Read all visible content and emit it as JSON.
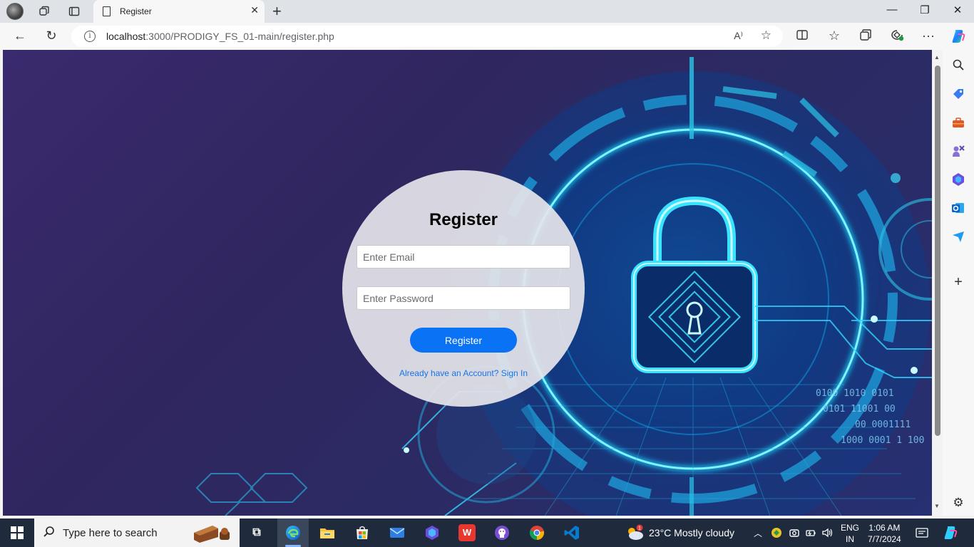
{
  "browser": {
    "tab_title": "Register",
    "url_host": "localhost",
    "url_rest": ":3000/PRODIGY_FS_01-main/register.php",
    "read_aloud": "A⁾"
  },
  "form": {
    "heading": "Register",
    "email_placeholder": "Enter Email",
    "password_placeholder": "Enter Password",
    "submit_label": "Register",
    "signin_link": "Already have an Account? Sign In"
  },
  "taskbar": {
    "search_placeholder": "Type here to search",
    "weather": "23°C  Mostly cloudy",
    "weather_badge": "1",
    "lang_line1": "ENG",
    "lang_line2": "IN",
    "time": "1:06 AM",
    "date": "7/7/2024"
  },
  "colors": {
    "accent": "#0a72f5",
    "link": "#1a73e8",
    "page_bg": "#30265f",
    "glow": "#18d8ff"
  },
  "icons": {
    "window_controls": [
      "minimize-icon",
      "restore-icon",
      "close-icon"
    ],
    "sidebar": [
      "search-icon",
      "tag-icon",
      "toolbox-icon",
      "games-icon",
      "copilot-icon",
      "outlook-icon",
      "send-icon",
      "add-icon",
      "settings-icon"
    ],
    "taskbar_apps": [
      "task-view-icon",
      "edge-icon",
      "file-explorer-icon",
      "store-icon",
      "mail-icon",
      "app-icon",
      "wps-icon",
      "github-icon",
      "chrome-icon",
      "vscode-icon"
    ]
  }
}
